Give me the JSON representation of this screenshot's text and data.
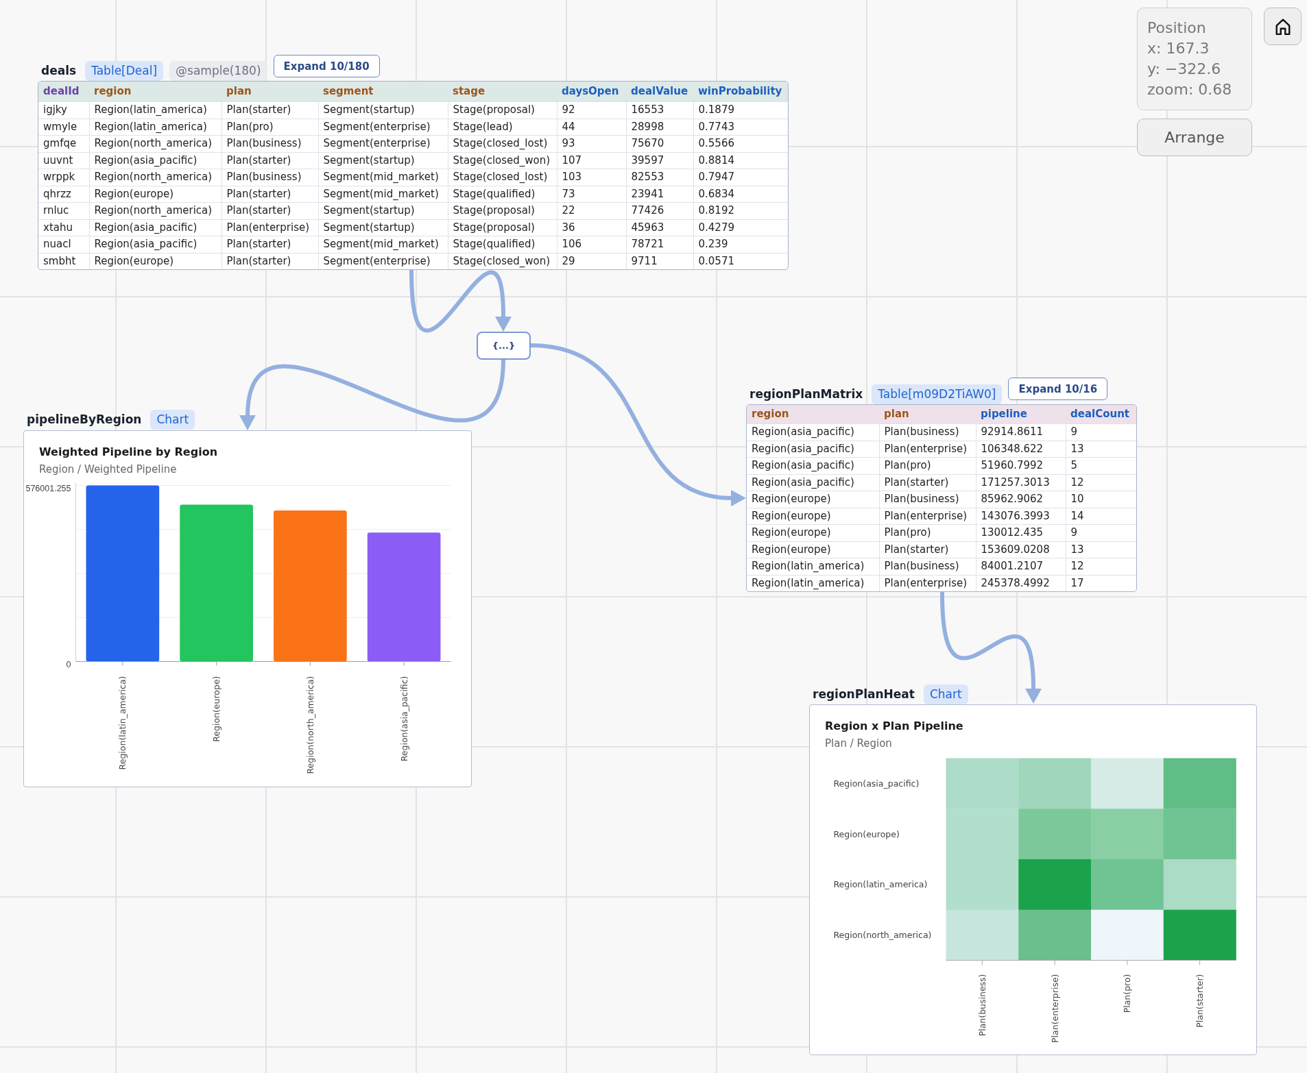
{
  "deals": {
    "title": "deals",
    "type_badge": "Table[Deal]",
    "sample_badge": "@sample(180)",
    "expand_button": "Expand 10/180",
    "table": {
      "columns": [
        {
          "label": "dealId",
          "kind": "key"
        },
        {
          "label": "region",
          "kind": "enum"
        },
        {
          "label": "plan",
          "kind": "enum"
        },
        {
          "label": "segment",
          "kind": "enum"
        },
        {
          "label": "stage",
          "kind": "enum"
        },
        {
          "label": "daysOpen",
          "kind": "number"
        },
        {
          "label": "dealValue",
          "kind": "number"
        },
        {
          "label": "winProbability",
          "kind": "number"
        }
      ],
      "rows": [
        [
          "igjky",
          "Region(latin_america)",
          "Plan(starter)",
          "Segment(startup)",
          "Stage(proposal)",
          "92",
          "16553",
          "0.1879"
        ],
        [
          "wmyle",
          "Region(latin_america)",
          "Plan(pro)",
          "Segment(enterprise)",
          "Stage(lead)",
          "44",
          "28998",
          "0.7743"
        ],
        [
          "gmfqe",
          "Region(north_america)",
          "Plan(business)",
          "Segment(enterprise)",
          "Stage(closed_lost)",
          "93",
          "75670",
          "0.5566"
        ],
        [
          "uuvnt",
          "Region(asia_pacific)",
          "Plan(starter)",
          "Segment(startup)",
          "Stage(closed_won)",
          "107",
          "39597",
          "0.8814"
        ],
        [
          "wrppk",
          "Region(north_america)",
          "Plan(business)",
          "Segment(mid_market)",
          "Stage(closed_lost)",
          "103",
          "82553",
          "0.7947"
        ],
        [
          "qhrzz",
          "Region(europe)",
          "Plan(starter)",
          "Segment(mid_market)",
          "Stage(qualified)",
          "73",
          "23941",
          "0.6834"
        ],
        [
          "rnluc",
          "Region(north_america)",
          "Plan(starter)",
          "Segment(startup)",
          "Stage(proposal)",
          "22",
          "77426",
          "0.8192"
        ],
        [
          "xtahu",
          "Region(asia_pacific)",
          "Plan(enterprise)",
          "Segment(startup)",
          "Stage(proposal)",
          "36",
          "45963",
          "0.4279"
        ],
        [
          "nuacl",
          "Region(asia_pacific)",
          "Plan(starter)",
          "Segment(mid_market)",
          "Stage(qualified)",
          "106",
          "78721",
          "0.239"
        ],
        [
          "smbht",
          "Region(europe)",
          "Plan(starter)",
          "Segment(enterprise)",
          "Stage(closed_won)",
          "29",
          "9711",
          "0.0571"
        ]
      ]
    }
  },
  "view_controls": {
    "position": {
      "heading": "Position",
      "x": "x: 167.3",
      "y": "y: −322.6",
      "zoom": "zoom: 0.68"
    },
    "arrange_button": "Arrange"
  },
  "transform_node": {
    "label": "{...}"
  },
  "region_plan_matrix": {
    "title": "regionPlanMatrix",
    "type_badge": "Table[m09D2TiAW0]",
    "expand_button": "Expand 10/16",
    "table": {
      "columns": [
        {
          "label": "region",
          "kind": "enum"
        },
        {
          "label": "plan",
          "kind": "enum"
        },
        {
          "label": "pipeline",
          "kind": "number"
        },
        {
          "label": "dealCount",
          "kind": "number"
        }
      ],
      "rows": [
        [
          "Region(asia_pacific)",
          "Plan(business)",
          "92914.8611",
          "9"
        ],
        [
          "Region(asia_pacific)",
          "Plan(enterprise)",
          "106348.622",
          "13"
        ],
        [
          "Region(asia_pacific)",
          "Plan(pro)",
          "51960.7992",
          "5"
        ],
        [
          "Region(asia_pacific)",
          "Plan(starter)",
          "171257.3013",
          "12"
        ],
        [
          "Region(europe)",
          "Plan(business)",
          "85962.9062",
          "10"
        ],
        [
          "Region(europe)",
          "Plan(enterprise)",
          "143076.3993",
          "14"
        ],
        [
          "Region(europe)",
          "Plan(pro)",
          "130012.435",
          "9"
        ],
        [
          "Region(europe)",
          "Plan(starter)",
          "153609.0208",
          "13"
        ],
        [
          "Region(latin_america)",
          "Plan(business)",
          "84001.2107",
          "12"
        ],
        [
          "Region(latin_america)",
          "Plan(enterprise)",
          "245378.4992",
          "17"
        ]
      ]
    }
  },
  "pipeline_by_region": {
    "title": "pipelineByRegion",
    "type_badge": "Chart",
    "chart_data": {
      "type": "bar",
      "title": "Weighted Pipeline by Region",
      "subtitle": "Region / Weighted Pipeline",
      "categories": [
        "Region(latin_america)",
        "Region(europe)",
        "Region(north_america)",
        "Region(asia_pacific)"
      ],
      "values": [
        576000,
        513000,
        494000,
        422000
      ],
      "colors": [
        "#2563eb",
        "#22c55e",
        "#f97316",
        "#8b5cf6"
      ],
      "ylim": [
        0,
        576001.255
      ],
      "yticks": [
        0,
        576001.255
      ]
    }
  },
  "region_plan_heat": {
    "title": "regionPlanHeat",
    "type_badge": "Chart",
    "chart": {
      "title": "Region x Plan Pipeline",
      "subtitle": "Plan / Region",
      "columns": [
        "Plan(business)",
        "Plan(enterprise)",
        "Plan(pro)",
        "Plan(starter)"
      ],
      "rows": [
        {
          "label": "Region(asia_pacific)",
          "cells": [
            {
              "color": "#acdcc7"
            },
            {
              "color": "#a0d7bc"
            },
            {
              "color": "#d6ebe6"
            },
            {
              "color": "#5fbd85"
            }
          ]
        },
        {
          "label": "Region(europe)",
          "cells": [
            {
              "color": "#b2dfcc"
            },
            {
              "color": "#7bc99a"
            },
            {
              "color": "#8acea6"
            },
            {
              "color": "#6fc493"
            }
          ]
        },
        {
          "label": "Region(latin_america)",
          "cells": [
            {
              "color": "#b2dfcc"
            },
            {
              "color": "#1ba34b"
            },
            {
              "color": "#6fc493"
            },
            {
              "color": "#abdcc5"
            }
          ]
        },
        {
          "label": "Region(north_america)",
          "cells": [
            {
              "color": "#c6e6dd"
            },
            {
              "color": "#69c08c"
            },
            {
              "color": "#eef5fb"
            },
            {
              "color": "#1ba34b"
            }
          ]
        }
      ]
    }
  }
}
